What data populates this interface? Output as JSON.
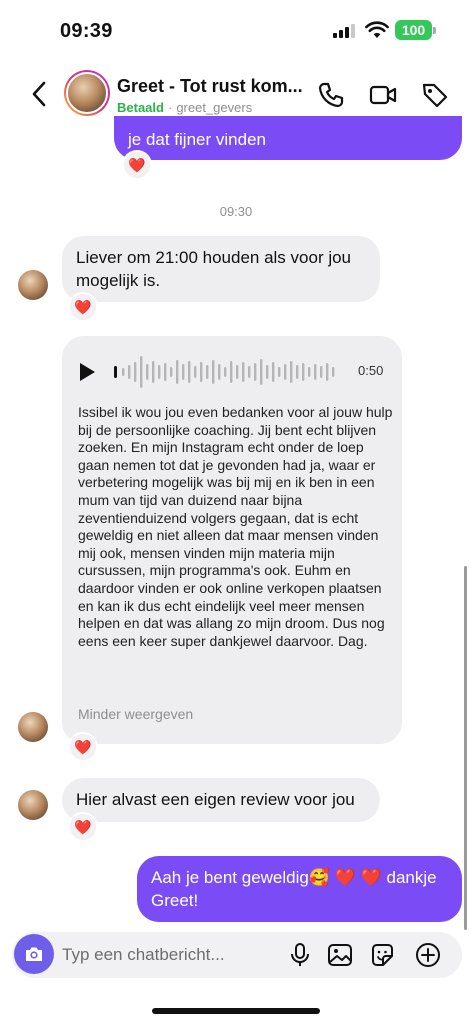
{
  "status_bar": {
    "time": "09:39",
    "battery": "100",
    "battery_color": "#34c759"
  },
  "header": {
    "contact_name": "Greet - Tot rust kom...",
    "paid_label": "Betaald",
    "separator": "·",
    "handle": "greet_gevers",
    "icons": [
      "back-icon",
      "phone-icon",
      "video-icon",
      "tag-icon"
    ]
  },
  "messages": {
    "top_outgoing": {
      "text": "je dat fijner vinden",
      "reaction": "❤️"
    },
    "timestamp": "09:30",
    "incoming_1": {
      "text": "Liever om 21:00 houden als voor jou mogelijk is.",
      "reaction": "❤️"
    },
    "voice": {
      "duration": "0:50",
      "transcript": "Issibel ik wou jou even bedanken voor al jouw hulp bij de persoonlijke coaching. Jij bent echt blijven zoeken. En mijn Instagram echt onder de loep gaan nemen tot dat je gevonden had ja, waar er verbetering mogelijk was bij mij en ik ben in een mum van tijd van duizend naar bijna zeventienduizend volgers gegaan, dat is echt geweldig en niet alleen dat maar mensen vinden mij ook, mensen vinden mijn materia mijn cursussen, mijn programma's ook. Euhm en daardoor vinden er ook online verkopen plaatsen en kan ik dus echt eindelijk veel meer mensen helpen en dat was allang zo mijn droom. Dus nog eens een keer super dankjewel daarvoor. Dag.",
      "collapse_label": "Minder weergeven",
      "reaction": "❤️"
    },
    "incoming_2": {
      "text": "Hier alvast een eigen review voor jou",
      "reaction": "❤️"
    },
    "outgoing_last": {
      "text": "Aah je bent geweldig🥰 ❤️ ❤️ dankje Greet!"
    }
  },
  "composer": {
    "placeholder": "Typ een chatbericht...",
    "icons": [
      "camera-icon",
      "microphone-icon",
      "gallery-icon",
      "sticker-icon",
      "plus-icon"
    ]
  },
  "colors": {
    "accent": "#7b4cf5",
    "camera_button": "#6f5ee9",
    "incoming_bubble": "#eeeef0",
    "paid_green": "#2bb24c"
  }
}
